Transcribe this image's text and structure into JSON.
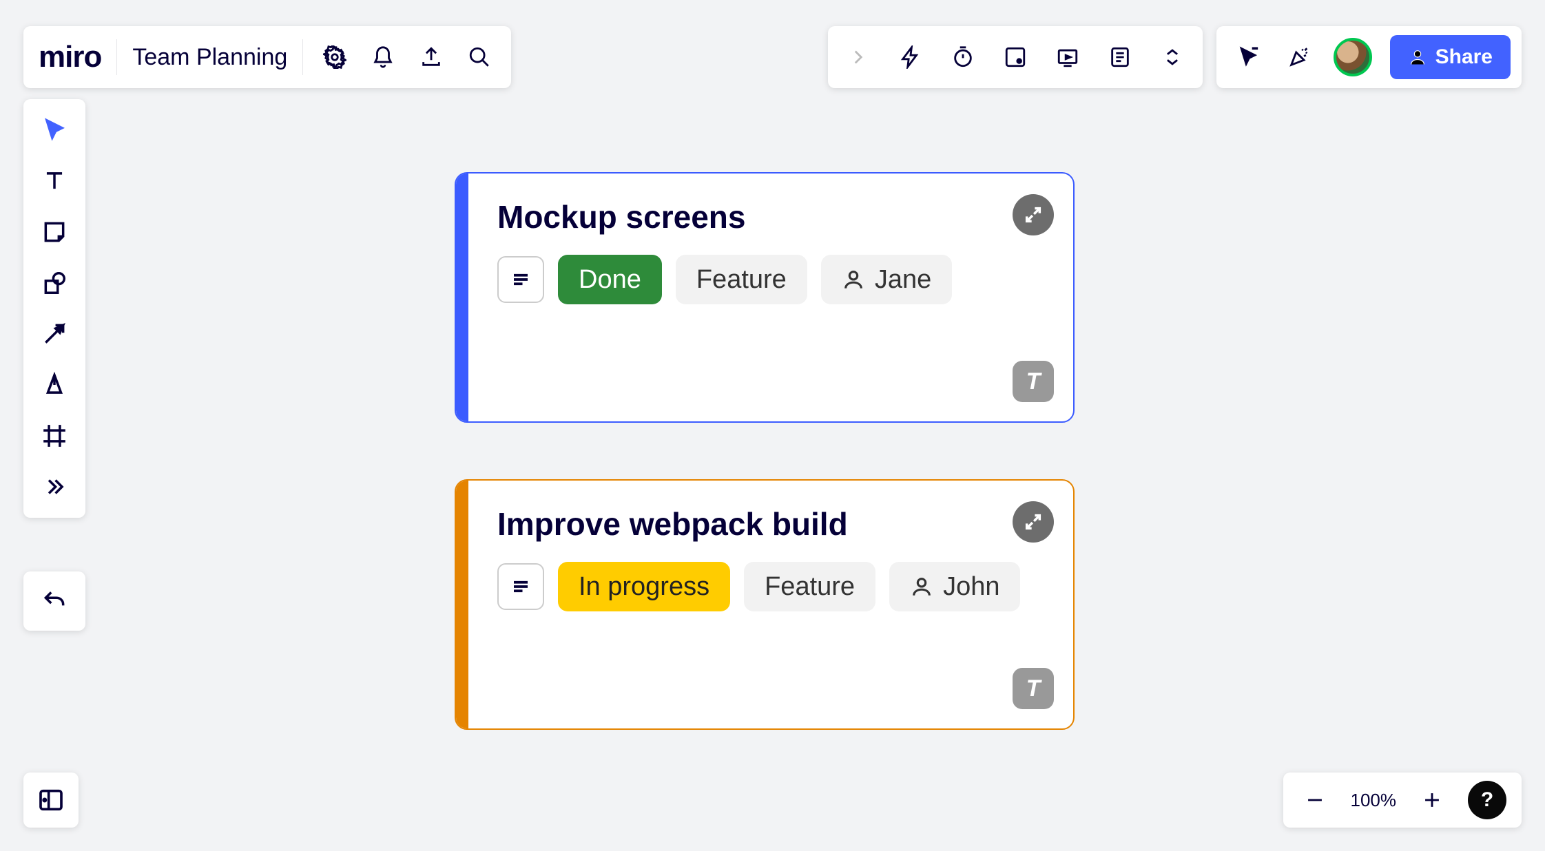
{
  "app": {
    "logo": "miro",
    "board_name": "Team Planning"
  },
  "share": {
    "label": "Share"
  },
  "zoom": {
    "level": "100%"
  },
  "help": {
    "label": "?"
  },
  "cards": [
    {
      "title": "Mockup screens",
      "status": "Done",
      "status_class": "status-done",
      "type": "Feature",
      "assignee": "Jane",
      "badge": "T",
      "accent": "#3b5bff"
    },
    {
      "title": "Improve webpack build",
      "status": "In progress",
      "status_class": "status-progress",
      "type": "Feature",
      "assignee": "John",
      "badge": "T",
      "accent": "#e58400"
    }
  ]
}
